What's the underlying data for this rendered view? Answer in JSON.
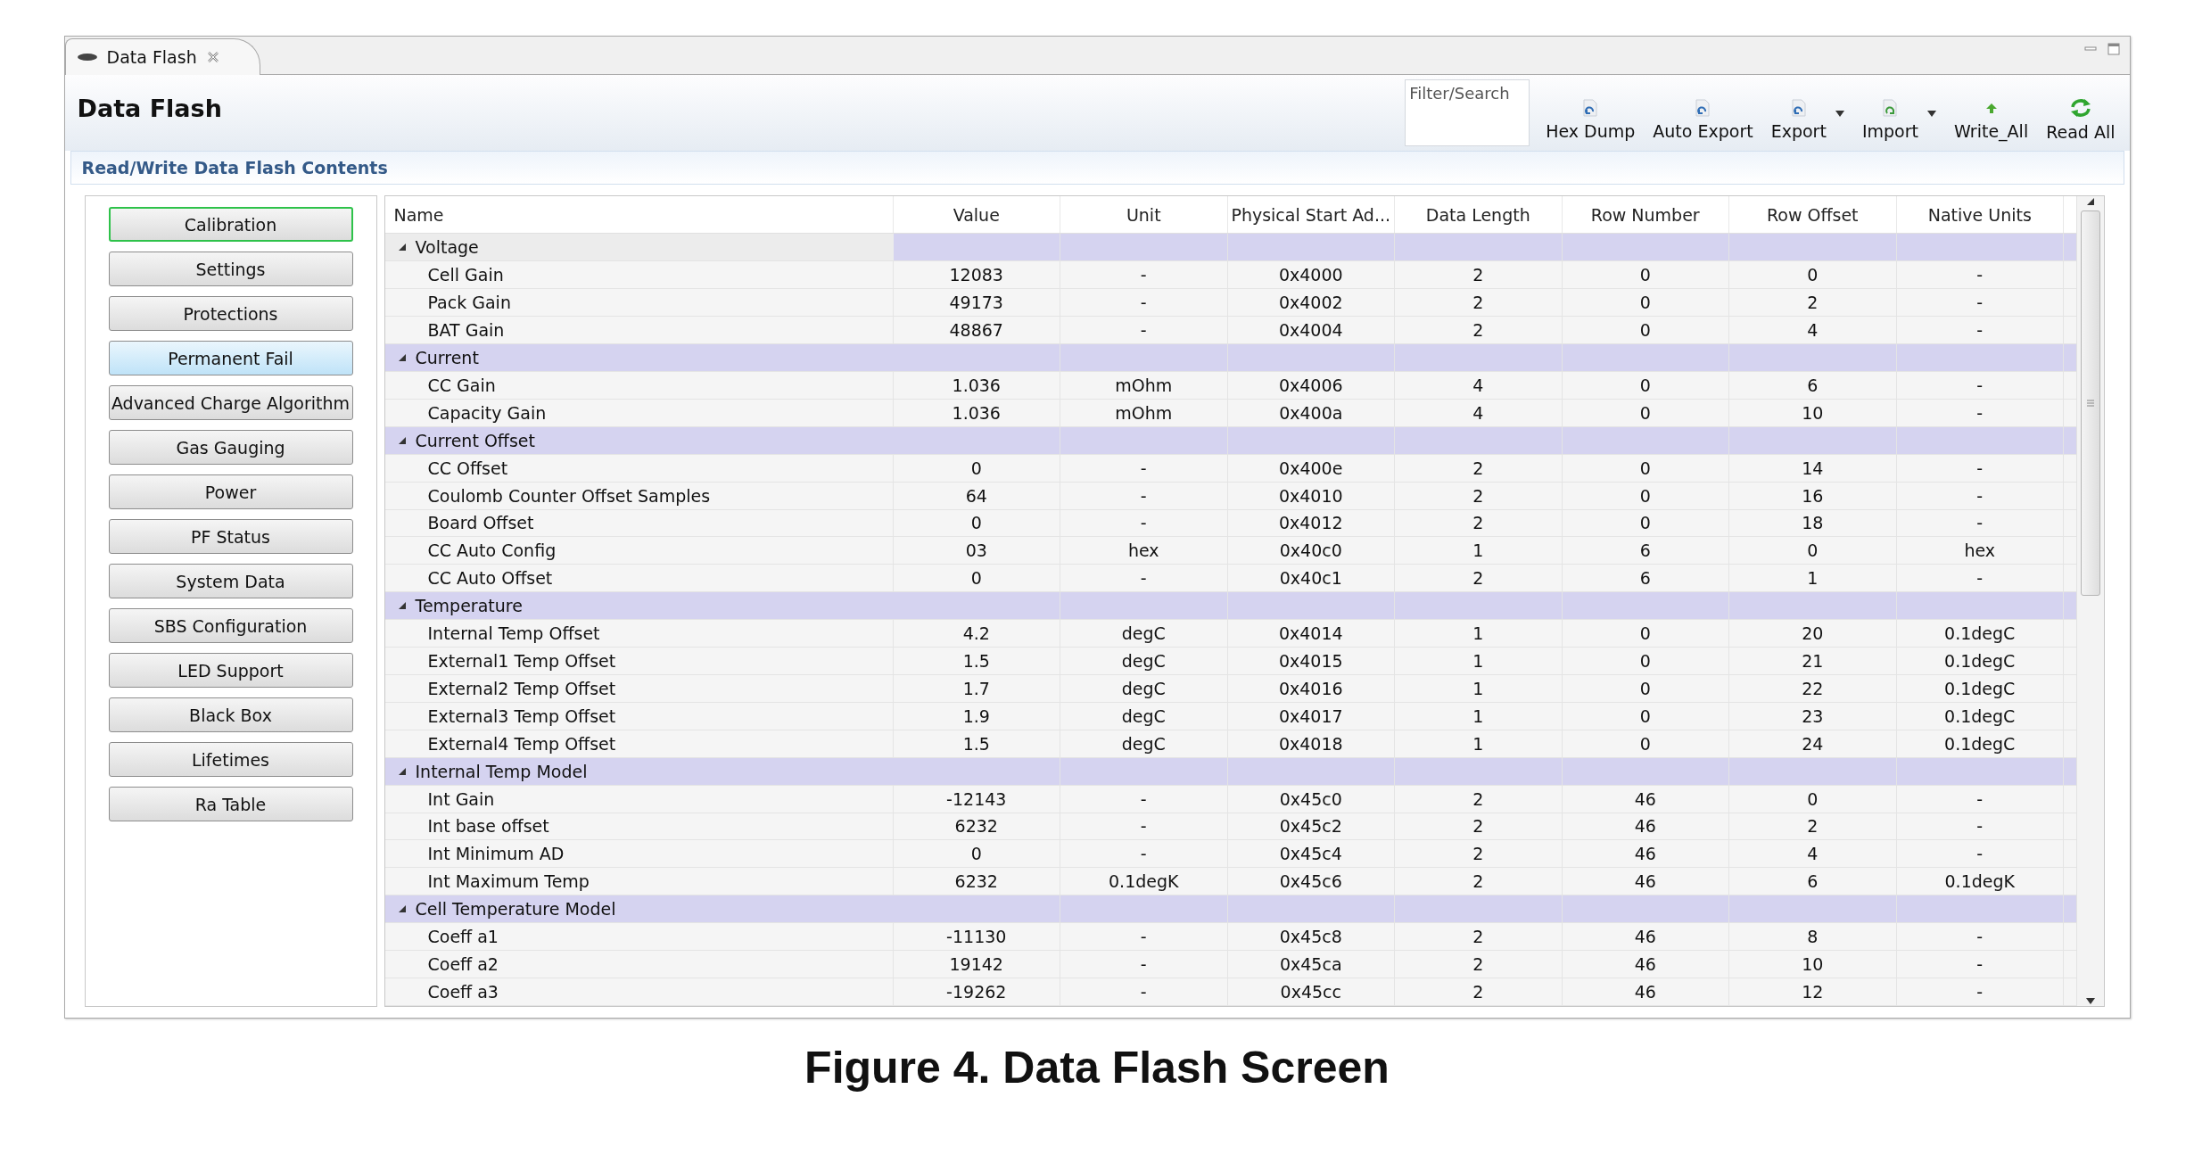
{
  "tab": {
    "label": "Data Flash"
  },
  "header": {
    "title": "Data Flash",
    "search": {
      "placeholder": "Filter/Search"
    },
    "tools": [
      {
        "label": "Hex Dump",
        "kind": "doc",
        "dropdown": false
      },
      {
        "label": "Auto Export",
        "kind": "doc",
        "dropdown": false
      },
      {
        "label": "Export",
        "kind": "doc",
        "dropdown": true
      },
      {
        "label": "Import",
        "kind": "import",
        "dropdown": true
      },
      {
        "label": "Write_All",
        "kind": "write",
        "dropdown": false
      },
      {
        "label": "Read All",
        "kind": "read",
        "dropdown": false
      }
    ]
  },
  "section": {
    "title": "Read/Write Data Flash Contents"
  },
  "categories": [
    {
      "label": "Calibration",
      "selected": true,
      "hovered": false
    },
    {
      "label": "Settings",
      "selected": false,
      "hovered": false
    },
    {
      "label": "Protections",
      "selected": false,
      "hovered": false
    },
    {
      "label": "Permanent Fail",
      "selected": false,
      "hovered": true
    },
    {
      "label": "Advanced Charge Algorithm",
      "selected": false,
      "hovered": false
    },
    {
      "label": "Gas Gauging",
      "selected": false,
      "hovered": false
    },
    {
      "label": "Power",
      "selected": false,
      "hovered": false
    },
    {
      "label": "PF Status",
      "selected": false,
      "hovered": false
    },
    {
      "label": "System Data",
      "selected": false,
      "hovered": false
    },
    {
      "label": "SBS Configuration",
      "selected": false,
      "hovered": false
    },
    {
      "label": "LED Support",
      "selected": false,
      "hovered": false
    },
    {
      "label": "Black Box",
      "selected": false,
      "hovered": false
    },
    {
      "label": "Lifetimes",
      "selected": false,
      "hovered": false
    },
    {
      "label": "Ra Table",
      "selected": false,
      "hovered": false
    }
  ],
  "table": {
    "columns": [
      "Name",
      "Value",
      "Unit",
      "Physical Start Ad...",
      "Data Length",
      "Row Number",
      "Row Offset",
      "Native Units"
    ],
    "groups": [
      {
        "name": "Voltage",
        "expanded": true,
        "selected": true,
        "children": [
          [
            "Cell Gain",
            "12083",
            "-",
            "0x4000",
            "2",
            "0",
            "0",
            "-"
          ],
          [
            "Pack Gain",
            "49173",
            "-",
            "0x4002",
            "2",
            "0",
            "2",
            "-"
          ],
          [
            "BAT Gain",
            "48867",
            "-",
            "0x4004",
            "2",
            "0",
            "4",
            "-"
          ]
        ]
      },
      {
        "name": "Current",
        "expanded": true,
        "selected": false,
        "children": [
          [
            "CC Gain",
            "1.036",
            "mOhm",
            "0x4006",
            "4",
            "0",
            "6",
            "-"
          ],
          [
            "Capacity Gain",
            "1.036",
            "mOhm",
            "0x400a",
            "4",
            "0",
            "10",
            "-"
          ]
        ]
      },
      {
        "name": "Current Offset",
        "expanded": true,
        "selected": false,
        "children": [
          [
            "CC Offset",
            "0",
            "-",
            "0x400e",
            "2",
            "0",
            "14",
            "-"
          ],
          [
            "Coulomb Counter Offset Samples",
            "64",
            "-",
            "0x4010",
            "2",
            "0",
            "16",
            "-"
          ],
          [
            "Board Offset",
            "0",
            "-",
            "0x4012",
            "2",
            "0",
            "18",
            "-"
          ],
          [
            "CC Auto Config",
            "03",
            "hex",
            "0x40c0",
            "1",
            "6",
            "0",
            "hex"
          ],
          [
            "CC Auto Offset",
            "0",
            "-",
            "0x40c1",
            "2",
            "6",
            "1",
            "-"
          ]
        ]
      },
      {
        "name": "Temperature",
        "expanded": true,
        "selected": false,
        "children": [
          [
            "Internal Temp Offset",
            "4.2",
            "degC",
            "0x4014",
            "1",
            "0",
            "20",
            "0.1degC"
          ],
          [
            "External1 Temp Offset",
            "1.5",
            "degC",
            "0x4015",
            "1",
            "0",
            "21",
            "0.1degC"
          ],
          [
            "External2 Temp Offset",
            "1.7",
            "degC",
            "0x4016",
            "1",
            "0",
            "22",
            "0.1degC"
          ],
          [
            "External3 Temp Offset",
            "1.9",
            "degC",
            "0x4017",
            "1",
            "0",
            "23",
            "0.1degC"
          ],
          [
            "External4 Temp Offset",
            "1.5",
            "degC",
            "0x4018",
            "1",
            "0",
            "24",
            "0.1degC"
          ]
        ]
      },
      {
        "name": "Internal Temp Model",
        "expanded": true,
        "selected": false,
        "children": [
          [
            "Int Gain",
            "-12143",
            "-",
            "0x45c0",
            "2",
            "46",
            "0",
            "-"
          ],
          [
            "Int base offset",
            "6232",
            "-",
            "0x45c2",
            "2",
            "46",
            "2",
            "-"
          ],
          [
            "Int Minimum AD",
            "0",
            "-",
            "0x45c4",
            "2",
            "46",
            "4",
            "-"
          ],
          [
            "Int Maximum Temp",
            "6232",
            "0.1degK",
            "0x45c6",
            "2",
            "46",
            "6",
            "0.1degK"
          ]
        ]
      },
      {
        "name": "Cell Temperature Model",
        "expanded": true,
        "selected": false,
        "children": [
          [
            "Coeff a1",
            "-11130",
            "-",
            "0x45c8",
            "2",
            "46",
            "8",
            "-"
          ],
          [
            "Coeff a2",
            "19142",
            "-",
            "0x45ca",
            "2",
            "46",
            "10",
            "-"
          ],
          [
            "Coeff a3",
            "-19262",
            "-",
            "0x45cc",
            "2",
            "46",
            "12",
            "-"
          ]
        ]
      }
    ]
  },
  "caption": "Figure 4. Data Flash Screen"
}
